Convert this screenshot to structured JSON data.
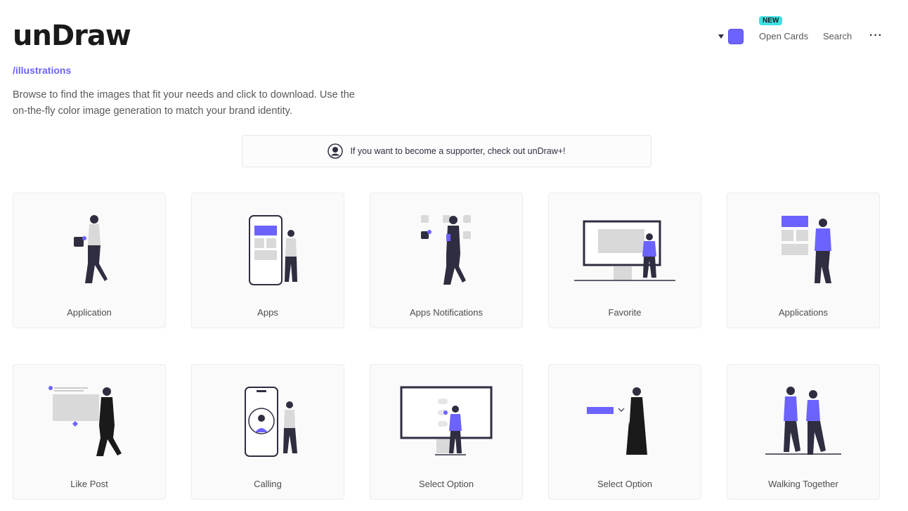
{
  "header": {
    "logo": "unDraw",
    "subtitle": "/illustrations",
    "intro": "Browse to find the images that fit your needs and click to download. Use the on-the-fly color image generation to match your brand identity."
  },
  "nav": {
    "accent_color": "#6c63ff",
    "new_badge": "NEW",
    "open_cards": "Open Cards",
    "search": "Search",
    "more": "···"
  },
  "supporter": {
    "text": "If you want to become a supporter, check out unDraw+!"
  },
  "illustrations": [
    {
      "title": "Application"
    },
    {
      "title": "Apps"
    },
    {
      "title": "Apps Notifications"
    },
    {
      "title": "Favorite"
    },
    {
      "title": "Applications"
    },
    {
      "title": "Like Post"
    },
    {
      "title": "Calling"
    },
    {
      "title": "Select Option"
    },
    {
      "title": "Select Option"
    },
    {
      "title": "Walking Together"
    }
  ]
}
